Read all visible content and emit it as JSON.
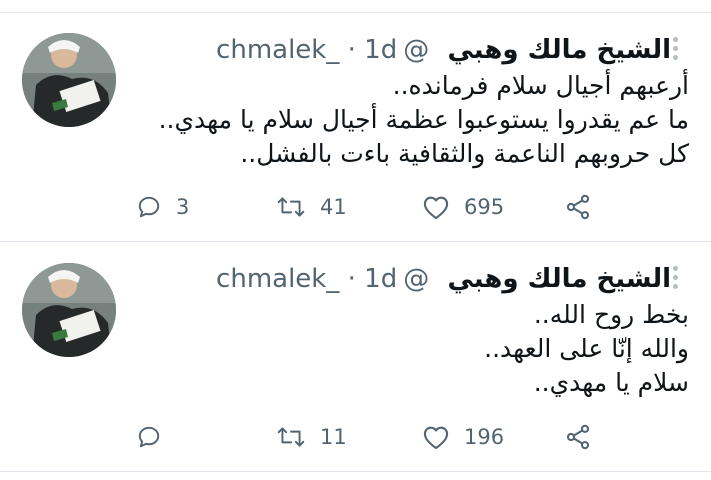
{
  "colors": {
    "text": "#0f1419",
    "secondary": "#536471",
    "divider": "#e1e8ed"
  },
  "tweets": [
    {
      "name": "الشيخ مالك وهبي",
      "handle": "@chmalek_",
      "time": "· 1d",
      "lines": [
        "أرعبهم أجيال سلام فرمانده..",
        "ما عم يقدروا يستوعبوا عظمة أجيال سلام يا مهدي..",
        "كل حروبهم الناعمة والثقافية باءت بالفشل.."
      ],
      "replies": "3",
      "retweets": "41",
      "likes": "695"
    },
    {
      "name": "الشيخ مالك وهبي",
      "handle": "@chmalek_",
      "time": "· 1d",
      "lines": [
        "بخط روح الله..",
        "والله إنّا على العهد..",
        "سلام يا مهدي.."
      ],
      "replies": "",
      "retweets": "11",
      "likes": "196"
    }
  ]
}
